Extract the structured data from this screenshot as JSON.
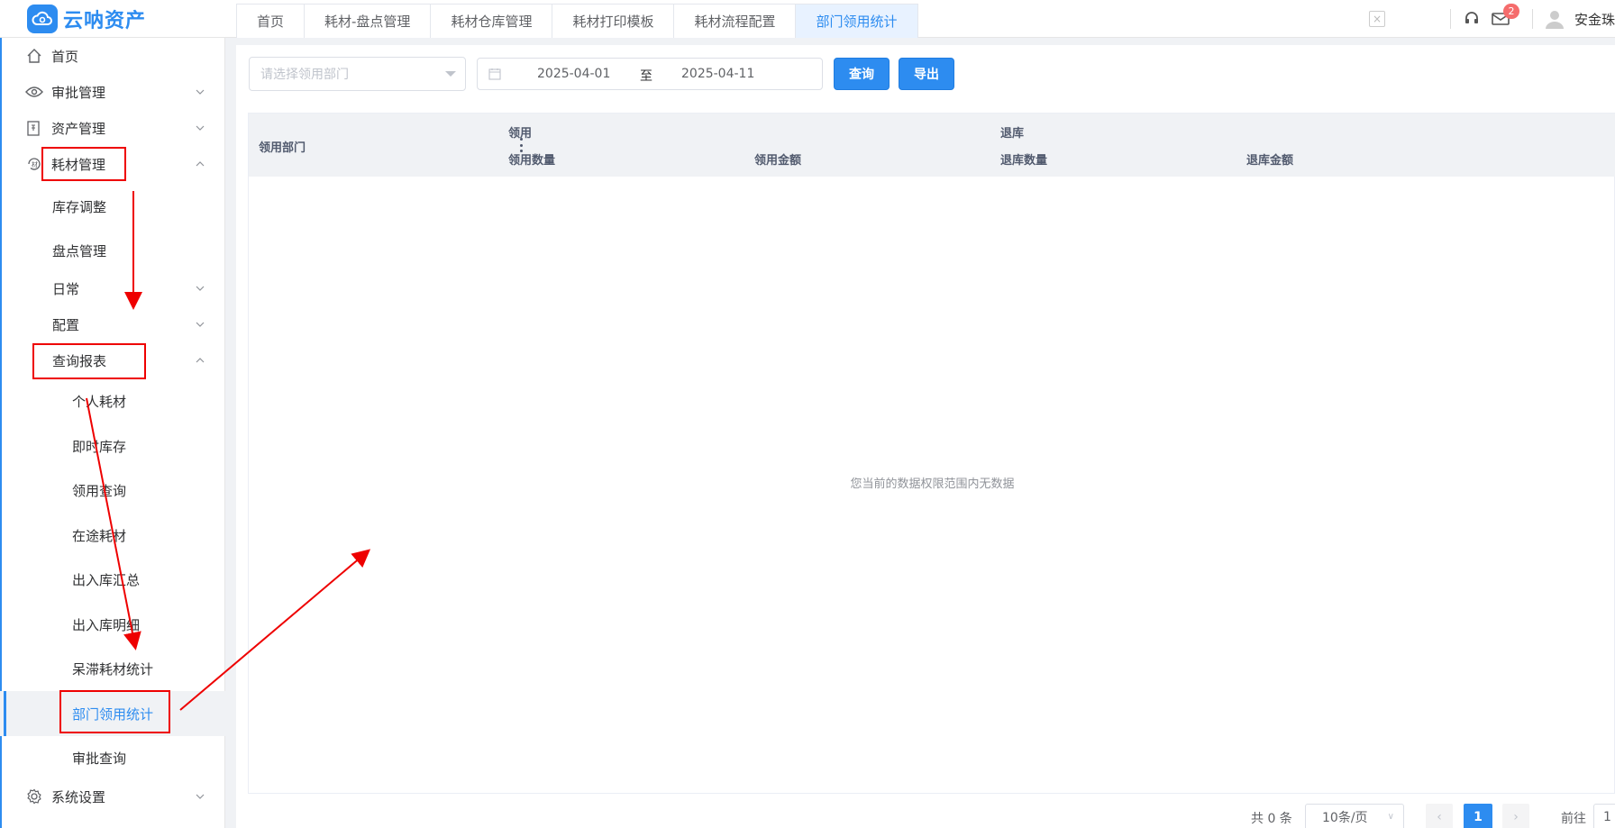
{
  "header": {
    "logo_text": "云呐资产",
    "tabs": [
      {
        "label": "首页",
        "active": false
      },
      {
        "label": "耗材-盘点管理",
        "active": false
      },
      {
        "label": "耗材仓库管理",
        "active": false
      },
      {
        "label": "耗材打印模板",
        "active": false
      },
      {
        "label": "耗材流程配置",
        "active": false
      },
      {
        "label": "部门领用统计",
        "active": true
      }
    ],
    "message_badge": "2",
    "user_name": "安金珠"
  },
  "sidebar": {
    "items": [
      {
        "label": "首页",
        "icon": "home-icon"
      },
      {
        "label": "审批管理",
        "icon": "eye-icon"
      },
      {
        "label": "资产管理",
        "icon": "asset-icon"
      },
      {
        "label": "耗材管理",
        "icon": "consumable-icon"
      },
      {
        "label": "库存调整"
      },
      {
        "label": "盘点管理"
      },
      {
        "label": "日常"
      },
      {
        "label": "配置"
      },
      {
        "label": "查询报表"
      },
      {
        "label": "个人耗材"
      },
      {
        "label": "即时库存"
      },
      {
        "label": "领用查询"
      },
      {
        "label": "在途耗材"
      },
      {
        "label": "出入库汇总"
      },
      {
        "label": "出入库明细"
      },
      {
        "label": "呆滞耗材统计"
      },
      {
        "label": "部门领用统计"
      },
      {
        "label": "审批查询"
      },
      {
        "label": "系统设置",
        "icon": "gear-icon"
      }
    ]
  },
  "filters": {
    "dept_placeholder": "请选择领用部门",
    "date_start": "2025-04-01",
    "date_sep": "至",
    "date_end": "2025-04-11",
    "query_label": "查询",
    "export_label": "导出"
  },
  "table": {
    "col_dept": "领用部门",
    "group_use": "领用",
    "col_use_qty": "领用数量",
    "col_use_amt": "领用金额",
    "group_return": "退库",
    "col_ret_qty": "退库数量",
    "col_ret_amt": "退库金额",
    "empty_text": "您当前的数据权限范围内无数据"
  },
  "pagination": {
    "total": "共 0 条",
    "page_size": "10条/页",
    "current_page": "1",
    "goto_label": "前往",
    "goto_value": "1"
  },
  "colors": {
    "accent": "#2d8cf0",
    "annotation": "#ee0000"
  }
}
